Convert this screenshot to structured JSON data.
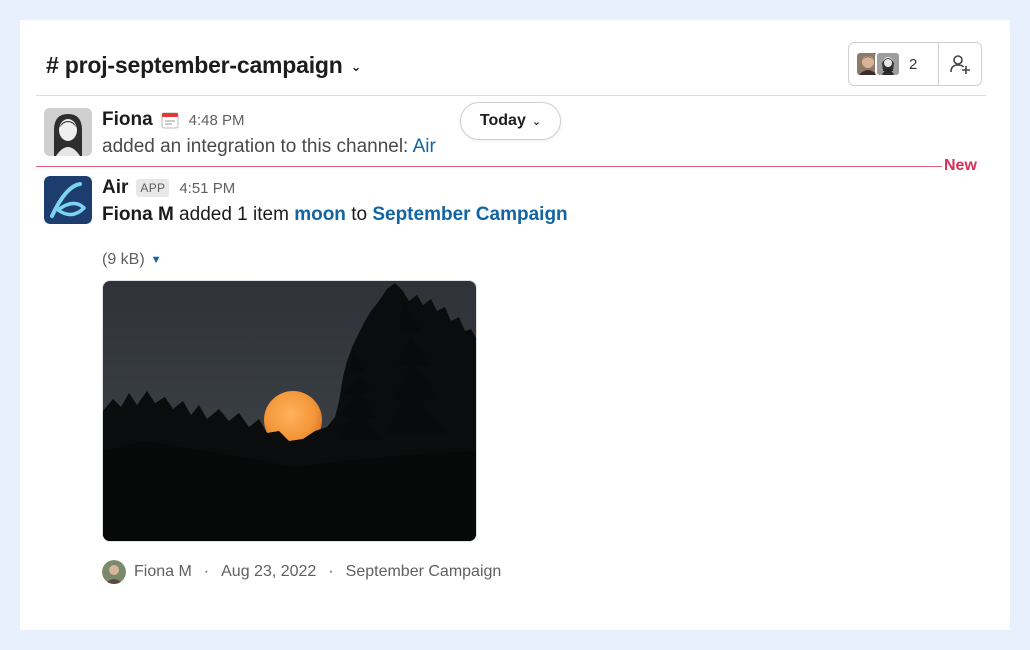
{
  "header": {
    "channel_name": "# proj-september-campaign",
    "member_count": "2"
  },
  "messages": [
    {
      "sender": "Fiona",
      "time": "4:48 PM",
      "text_prefix": "added an integration to this channel: ",
      "text_link": "Air"
    },
    {
      "sender": "Air",
      "badge": "APP",
      "time": "4:51 PM",
      "actor": "Fiona M",
      "action": " added 1 item ",
      "item_link": "moon",
      "to_text": " to ",
      "collection_link": "September Campaign"
    }
  ],
  "date_pill": {
    "label": "Today"
  },
  "divider": {
    "label": "New"
  },
  "attachment": {
    "file_size": "(9 kB)",
    "footer": {
      "author": "Fiona M",
      "date": "Aug 23, 2022",
      "collection": "September Campaign",
      "separator": "·"
    }
  },
  "colors": {
    "link": "#1264a3",
    "new_divider": "#e0607e",
    "new_label": "#d4315a",
    "air_brand": "#1c3d6e"
  }
}
